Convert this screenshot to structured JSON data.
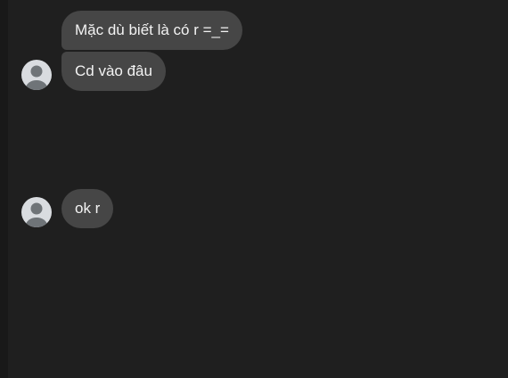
{
  "conversation": {
    "groups": [
      {
        "sender_avatar_icon": "default-user-avatar-icon",
        "messages": [
          {
            "text": "Mặc dù biết là có r =_="
          },
          {
            "text": "Cd vào đâu"
          }
        ]
      },
      {
        "sender_avatar_icon": "default-user-avatar-icon",
        "messages": [
          {
            "text": "ok r"
          }
        ]
      }
    ]
  },
  "colors": {
    "background": "#1f1f1f",
    "bubble": "#464646",
    "bubble_text": "#f3f3f3",
    "avatar_bg": "#d9dce0",
    "avatar_figure": "#6f7478"
  }
}
